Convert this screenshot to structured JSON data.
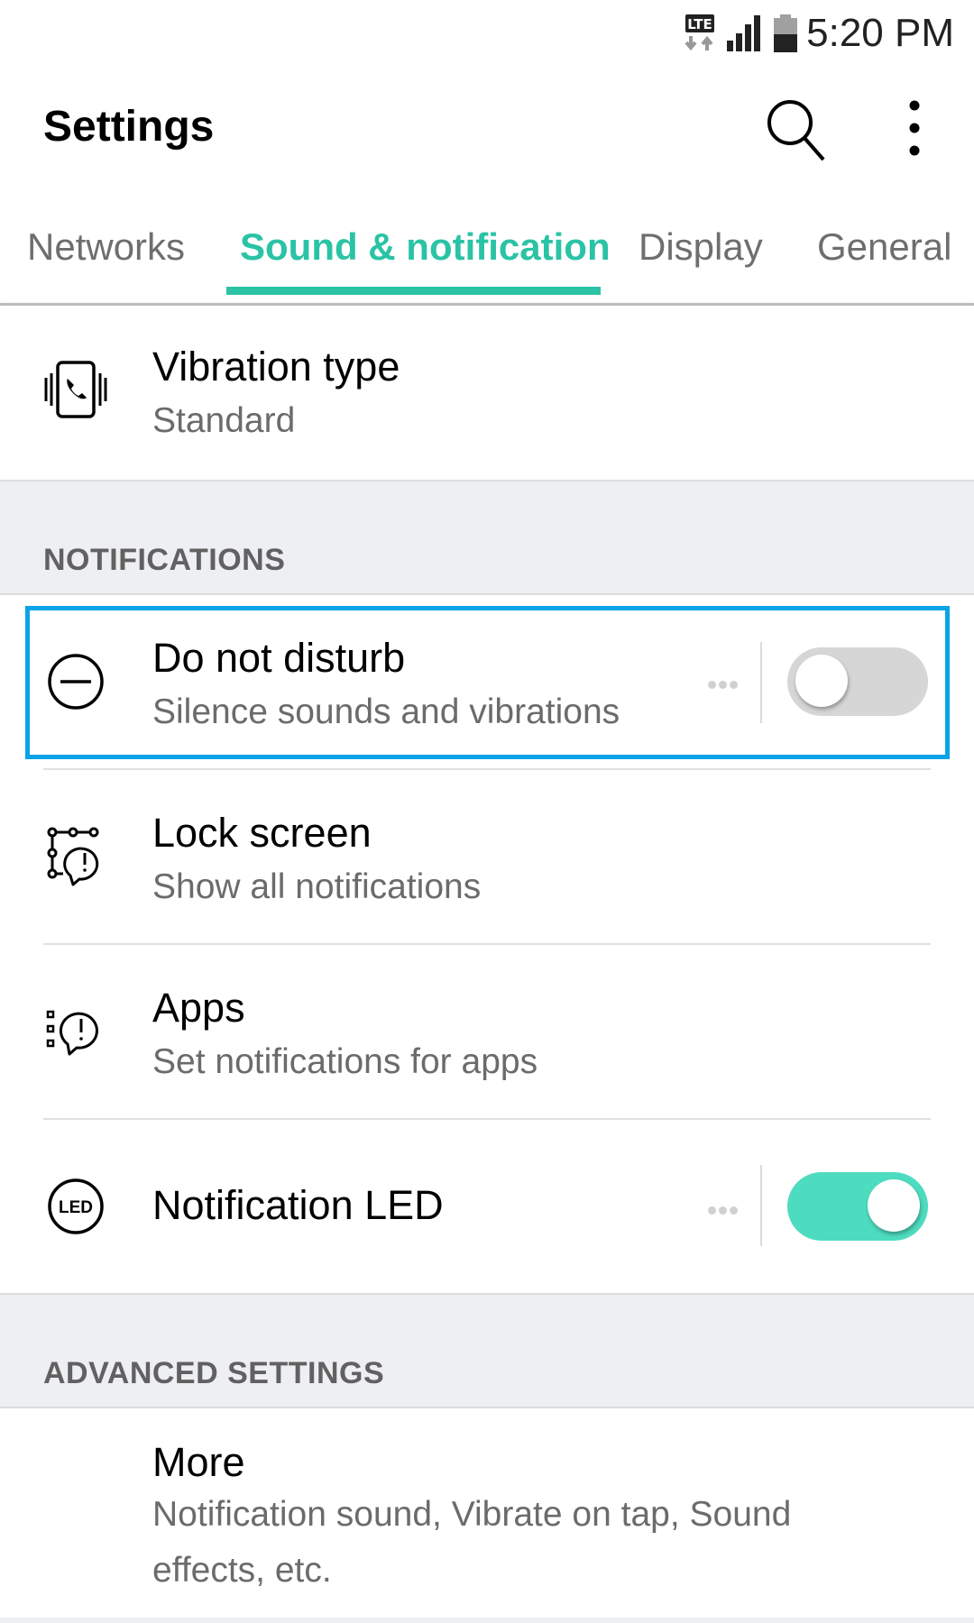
{
  "status_bar": {
    "network_label": "LTE",
    "time": "5:20 PM",
    "icons": [
      "lte-data-icon",
      "signal-icon",
      "battery-icon"
    ]
  },
  "app_bar": {
    "title": "Settings",
    "actions": [
      "search-icon",
      "more-vert-icon"
    ]
  },
  "tabs": [
    {
      "label": "Networks",
      "active": false
    },
    {
      "label": "Sound & notification",
      "active": true
    },
    {
      "label": "Display",
      "active": false
    },
    {
      "label": "General",
      "active": false
    }
  ],
  "colors": {
    "accent": "#2bc3a5",
    "toggle_on": "#4ddcbf",
    "toggle_off": "#d6d6d6",
    "focus_border": "#0aa3e8",
    "section_bg": "#eeeff2"
  },
  "rows_top": [
    {
      "icon": "vibration-phone-icon",
      "title": "Vibration type",
      "subtitle": "Standard"
    }
  ],
  "sections": [
    {
      "label": "NOTIFICATIONS",
      "items": [
        {
          "icon": "do-not-disturb-icon",
          "title": "Do not disturb",
          "subtitle": "Silence sounds and vibrations",
          "toggle": false,
          "focused": true
        },
        {
          "icon": "lock-screen-notification-icon",
          "title": "Lock screen",
          "subtitle": "Show all notifications"
        },
        {
          "icon": "app-notification-icon",
          "title": "Apps",
          "subtitle": "Set notifications for apps"
        },
        {
          "icon": "led-icon",
          "title": "Notification LED",
          "toggle": true
        }
      ]
    },
    {
      "label": "ADVANCED SETTINGS",
      "items": [
        {
          "title": "More",
          "subtitle_line1": "Notification sound, Vibrate on tap, Sound",
          "subtitle_line2": "effects, etc."
        }
      ]
    }
  ]
}
